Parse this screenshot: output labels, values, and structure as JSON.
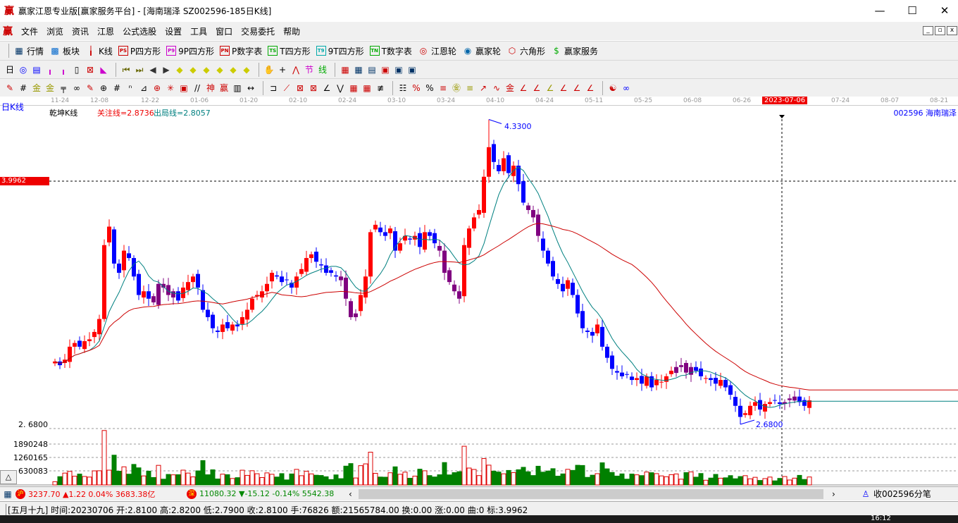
{
  "window": {
    "title": "赢家江恩专业版[赢家服务平台] - [海南瑞泽  SZ002596-185日K线]",
    "logo": "赢",
    "minimize": "—",
    "maximize": "☐",
    "close": "✕"
  },
  "menu": {
    "logo": "赢",
    "items": [
      "文件",
      "浏览",
      "资讯",
      "江恩",
      "公式选股",
      "设置",
      "工具",
      "窗口",
      "交易委托",
      "帮助"
    ]
  },
  "toolbar1": [
    {
      "icon": "grid-icon",
      "label": "行情"
    },
    {
      "icon": "blocks-icon",
      "label": "板块"
    },
    {
      "icon": "kline-icon",
      "label": "K线"
    },
    {
      "icon": "PS",
      "label": "P四方形"
    },
    {
      "icon": "P9",
      "label": "9P四方形"
    },
    {
      "icon": "PN",
      "label": "P数字表"
    },
    {
      "icon": "TS",
      "label": "T四方形"
    },
    {
      "icon": "T9",
      "label": "9T四方形"
    },
    {
      "icon": "TN",
      "label": "T数字表"
    },
    {
      "icon": "gann-wheel-icon",
      "label": "江恩轮"
    },
    {
      "icon": "big-wheel-icon",
      "label": "赢家轮"
    },
    {
      "icon": "hexagon-icon",
      "label": "六角形"
    },
    {
      "icon": "dollar-icon",
      "label": "赢家服务"
    }
  ],
  "chart": {
    "period_label": "日K线",
    "indicator_name": "乾坤K线",
    "focus_line": "关注线=2.8736",
    "exit_line": "出局线=2.8057",
    "stock_label": "002596  海南瑞泽",
    "crosshair_price": "3.9962",
    "high_label": "4.3300",
    "low_label": "2.6800",
    "low_axis_label": "2. 6800",
    "volume_ticks": [
      "1890248",
      "1260165",
      "630083"
    ],
    "dates": [
      "11-24",
      "12-08",
      "12-22",
      "01-06",
      "01-20",
      "02-10",
      "02-24",
      "03-10",
      "03-24",
      "04-10",
      "04-24",
      "05-11",
      "05-25",
      "06-08",
      "06-26",
      "2023-07-06",
      "07-24",
      "08-07",
      "08-21"
    ],
    "colors": {
      "up": "#ff0000",
      "down": "#0000ff",
      "special": "#800080",
      "ma_fast": "#008080",
      "ma_slow": "#cc0000",
      "vol_up": "#dd0000",
      "vol_down": "#008000"
    }
  },
  "chart_data": {
    "type": "candlestick",
    "closes": [
      3.02,
      3.0,
      3.03,
      3.1,
      3.12,
      3.1,
      3.13,
      3.14,
      3.18,
      3.25,
      3.65,
      3.75,
      3.55,
      3.5,
      3.62,
      3.58,
      3.48,
      3.38,
      3.4,
      3.36,
      3.34,
      3.44,
      3.42,
      3.38,
      3.4,
      3.35,
      3.42,
      3.45,
      3.48,
      3.42,
      3.3,
      3.26,
      3.2,
      3.18,
      3.22,
      3.2,
      3.22,
      3.21,
      3.26,
      3.3,
      3.36,
      3.38,
      3.4,
      3.44,
      3.5,
      3.48,
      3.45,
      3.46,
      3.42,
      3.48,
      3.52,
      3.58,
      3.6,
      3.56,
      3.54,
      3.5,
      3.5,
      3.48,
      3.46,
      3.36,
      3.26,
      3.28,
      3.38,
      3.48,
      3.72,
      3.76,
      3.72,
      3.7,
      3.74,
      3.62,
      3.66,
      3.7,
      3.68,
      3.7,
      3.64,
      3.72,
      3.7,
      3.66,
      3.62,
      3.5,
      3.45,
      3.4,
      3.36,
      3.65,
      3.74,
      3.8,
      3.84,
      4.02,
      4.18,
      4.1,
      4.05,
      4.12,
      4.04,
      4.08,
      3.98,
      3.88,
      3.84,
      3.8,
      3.7,
      3.62,
      3.55,
      3.48,
      3.44,
      3.4,
      3.46,
      3.38,
      3.28,
      3.2,
      3.18,
      3.16,
      3.22,
      3.1,
      3.04,
      2.98,
      2.96,
      2.94,
      2.95,
      2.92,
      2.93,
      2.9,
      2.94,
      2.88,
      2.92,
      2.91,
      2.94,
      2.97,
      2.99,
      3.0,
      2.96,
      2.99,
      2.97,
      2.94,
      2.93,
      2.92,
      2.9,
      2.92,
      2.88,
      2.84,
      2.78,
      2.72,
      2.74,
      2.78,
      2.8,
      2.76,
      2.79,
      2.8,
      2.81,
      2.79,
      2.8,
      2.82,
      2.83,
      2.8,
      2.78,
      2.81
    ],
    "special_ranges": [
      [
        20,
        24
      ],
      [
        58,
        61
      ],
      [
        78,
        82
      ],
      [
        96,
        98
      ],
      [
        126,
        129
      ],
      [
        148,
        150
      ]
    ],
    "max_high": {
      "index": 88,
      "value": 4.33
    },
    "min_low": {
      "index": 139,
      "value": 2.68
    },
    "price_ref": 3.9962,
    "ma_fast_period": 8,
    "ma_slow_period": 35
  },
  "bottom": {
    "sh_badge": "沪",
    "sh_text": "3237.70 ▲1.22 0.04% 3683.38亿",
    "sz_badge": "深",
    "sz_text": "11080.32 ▼-15.12 -0.14% 5542.38",
    "scroll_left": "‹",
    "scroll_right": "›",
    "tick_label": "收002596分笔"
  },
  "status": "[五月十九] 时间:20230706 开:2.8100 高:2.8200 低:2.7900 收:2.8100 手:76826 额:21565784.00 换:0.00 涨:0.00 曲:0 标:3.9962",
  "taskbar": {
    "clock": "16:12"
  }
}
